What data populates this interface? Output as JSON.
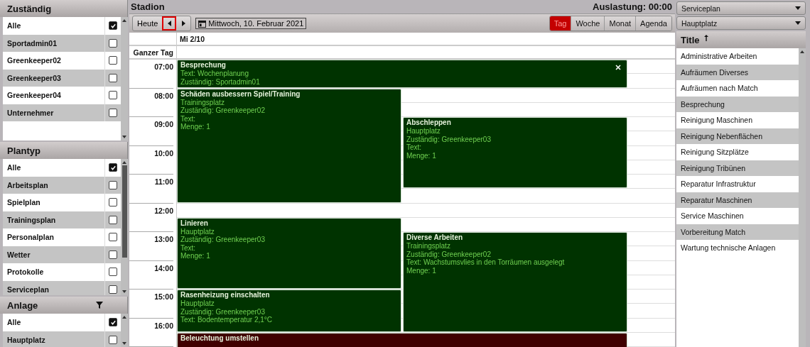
{
  "title": "Stadion",
  "utilization": "Auslastung: 00:00",
  "toolbar": {
    "today": "Heute",
    "prev": {
      "focused": true
    },
    "next": {
      "focused": false
    },
    "date": "Mittwoch, 10. Februar 2021"
  },
  "views": [
    {
      "label": "Tag",
      "selected": true
    },
    {
      "label": "Woche",
      "selected": false
    },
    {
      "label": "Monat",
      "selected": false
    },
    {
      "label": "Agenda",
      "selected": false
    }
  ],
  "filters": [
    {
      "title": "Zuständig",
      "filter_icon": false,
      "items": [
        {
          "label": "Alle",
          "checked": true
        },
        {
          "label": "Sportadmin01",
          "checked": false
        },
        {
          "label": "Greenkeeper02",
          "checked": false
        },
        {
          "label": "Greenkeeper03",
          "checked": false
        },
        {
          "label": "Greenkeeper04",
          "checked": false
        },
        {
          "label": "Unternehmer",
          "checked": false
        }
      ]
    },
    {
      "title": "Plantyp",
      "filter_icon": false,
      "items": [
        {
          "label": "Alle",
          "checked": true
        },
        {
          "label": "Arbeitsplan",
          "checked": false
        },
        {
          "label": "Spielplan",
          "checked": false
        },
        {
          "label": "Trainingsplan",
          "checked": false
        },
        {
          "label": "Personalplan",
          "checked": false
        },
        {
          "label": "Wetter",
          "checked": false
        },
        {
          "label": "Protokolle",
          "checked": false
        },
        {
          "label": "Serviceplan",
          "checked": false
        }
      ]
    },
    {
      "title": "Anlage",
      "filter_icon": true,
      "items": [
        {
          "label": "Alle",
          "checked": true
        },
        {
          "label": "Hauptplatz",
          "checked": false
        }
      ]
    }
  ],
  "calendar": {
    "day_header": "Mi 2/10",
    "all_day_label": "Ganzer Tag",
    "hours": [
      "07:00",
      "08:00",
      "09:00",
      "10:00",
      "11:00",
      "12:00",
      "13:00",
      "14:00",
      "15:00",
      "16:00"
    ],
    "events": [
      {
        "title": "Besprechung",
        "lines": [
          "Text: Wochenplanung",
          "Zuständig: Sportadmin01"
        ],
        "color": "#003300",
        "closable": true
      },
      {
        "title": "Schäden ausbessern Spiel/Training",
        "lines": [
          "Trainingsplatz",
          "Zuständig: Greenkeeper02",
          "Text:",
          "Menge: 1"
        ],
        "color": "#003300",
        "closable": false
      },
      {
        "title": "Abschleppen",
        "lines": [
          "Hauptplatz",
          "Zuständig: Greenkeeper03",
          "Text:",
          "Menge: 1"
        ],
        "color": "#003300",
        "closable": false
      },
      {
        "title": "Linieren",
        "lines": [
          "Hauptplatz",
          "Zuständig: Greenkeeper03",
          "Text:",
          "Menge: 1"
        ],
        "color": "#003300",
        "closable": false
      },
      {
        "title": "Diverse Arbeiten",
        "lines": [
          "Trainingsplatz",
          "Zuständig: Greenkeeper02",
          "Text: Wachstumsvlies in den Torräumen ausgelegt",
          "Menge: 1"
        ],
        "color": "#003300",
        "closable": false
      },
      {
        "title": "Rasenheizung einschalten",
        "lines": [
          "Hauptplatz",
          "Zuständig: Greenkeeper03",
          "Text: Bodentemperatur 2,1°C"
        ],
        "color": "#003300",
        "closable": false
      },
      {
        "title": "Beleuchtung umstellen",
        "color": "#400000",
        "closable": false
      }
    ]
  },
  "right_panel": {
    "dropdowns": [
      "Serviceplan",
      "Hauptplatz"
    ],
    "list_header": "Title",
    "sort_ascending": true,
    "items": [
      "Administrative Arbeiten",
      "Aufräumen Diverses",
      "Aufräumen nach Match",
      "Besprechung",
      "Reinigung Maschinen",
      "Reinigung Nebenflächen",
      "Reinigung Sitzplätze",
      "Reinigung Tribünen",
      "Reparatur Infrastruktur",
      "Reparatur Maschinen",
      "Service Maschinen",
      "Vorbereitung Match",
      "Wartung technische Anlagen"
    ]
  }
}
